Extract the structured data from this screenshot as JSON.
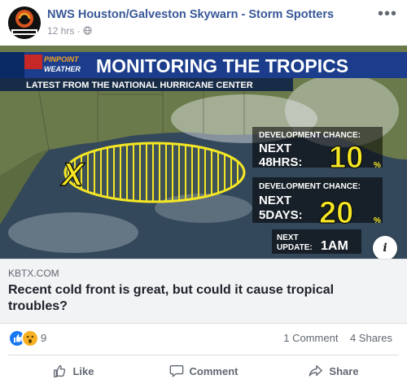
{
  "post": {
    "page_name": "NWS Houston/Galveston Skywarn - Storm Spotters",
    "timestamp": "12 hrs",
    "privacy_icon": "globe-icon",
    "more_label": "•••"
  },
  "graphic": {
    "brand_top": "PINPOINT",
    "brand_bottom": "WEATHER",
    "title": "MONITORING THE TROPICS",
    "subtitle": "LATEST FROM THE NATIONAL HURRICANE CENTER",
    "marker": "X",
    "dev1_label": "DEVELOPMENT CHANCE:",
    "dev1_period_line1": "NEXT",
    "dev1_period_line2": "48HRS:",
    "dev1_value": "10",
    "dev2_label": "DEVELOPMENT CHANCE:",
    "dev2_period_line1": "NEXT",
    "dev2_period_line2": "5DAYS:",
    "dev2_value": "20",
    "percent": "%",
    "update_line1": "NEXT",
    "update_line2": "UPDATE:",
    "update_time": "1AM",
    "colors": {
      "title_bg": "#1b3d8c",
      "accent": "#f5e625",
      "map_land": "#6b7a4a",
      "gulf": "#33485a"
    }
  },
  "info_icon_label": "i",
  "link": {
    "domain": "KBTX.COM",
    "headline": "Recent cold front is great, but could it cause tropical troubles?"
  },
  "stats": {
    "reaction_count": "9",
    "comments": "1 Comment",
    "shares": "4 Shares"
  },
  "actions": {
    "like": "Like",
    "comment": "Comment",
    "share": "Share"
  }
}
